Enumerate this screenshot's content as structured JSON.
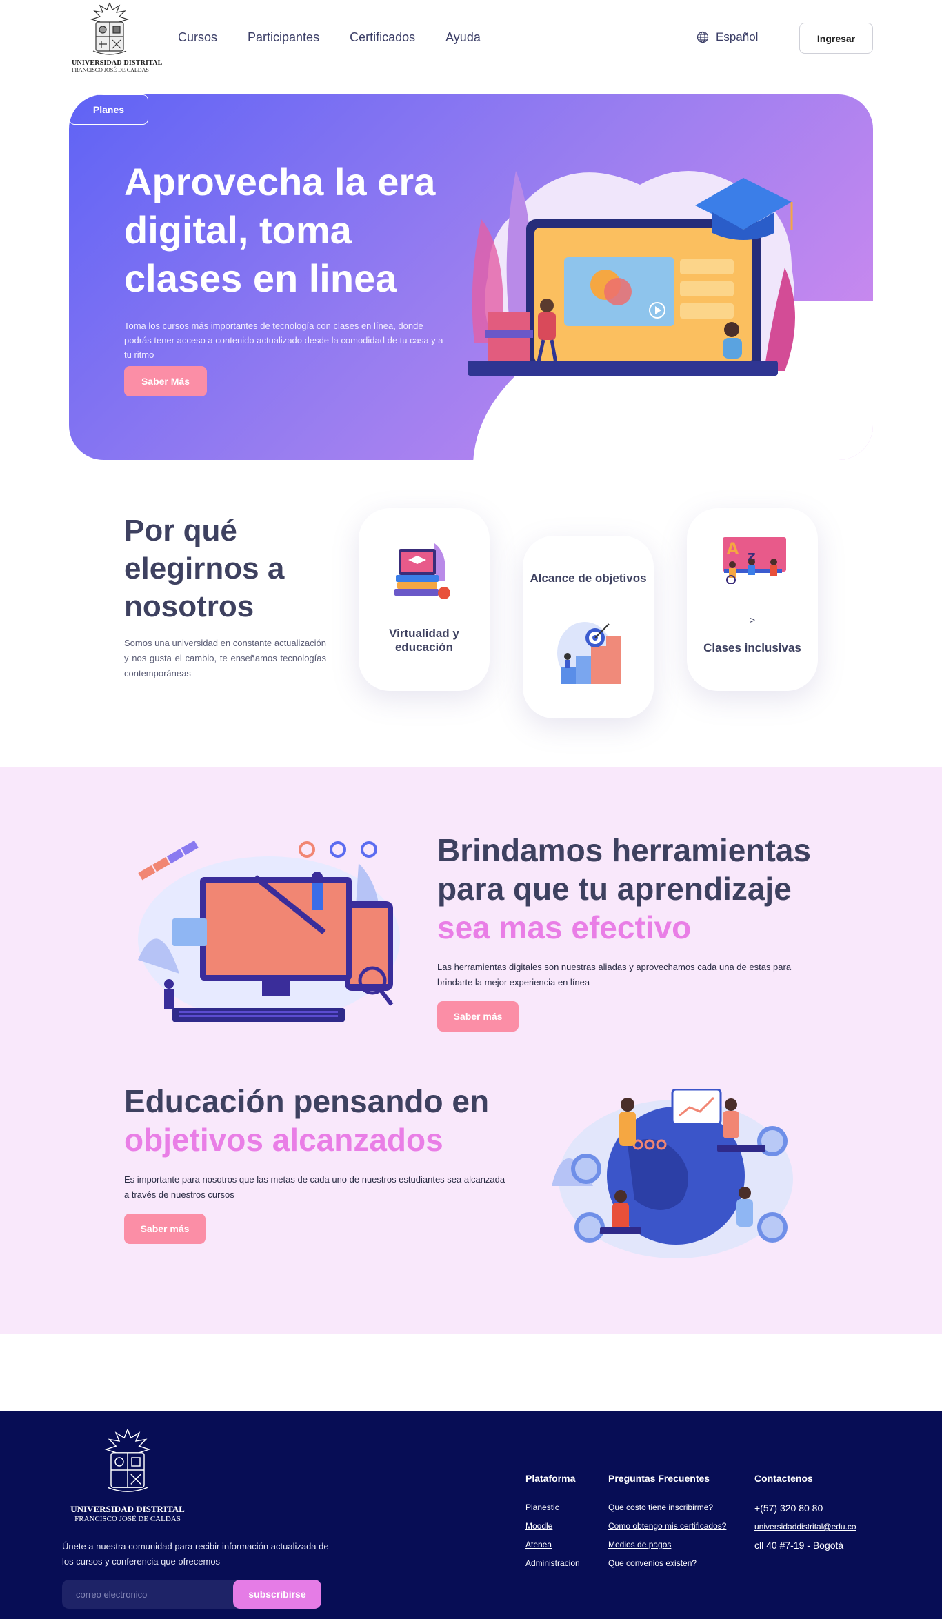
{
  "header": {
    "logo_line1": "UNIVERSIDAD DISTRITAL",
    "logo_line2": "FRANCISCO JOSÉ DE CALDAS",
    "nav": [
      "Cursos",
      "Participantes",
      "Certificados",
      "Ayuda"
    ],
    "language": "Español",
    "login_label": "Ingresar"
  },
  "hero": {
    "title": "Aprovecha la era digital, toma clases en linea",
    "text": "Toma los cursos más importantes de tecnología con clases en línea, donde podrás tener acceso a contenido actualizado desde la comodidad de tu casa y a tu ritmo",
    "primary_label": "Saber Más",
    "secondary_label": "Planes"
  },
  "why": {
    "title": "Por qué elegirnos a nosotros",
    "text": "Somos una universidad en constante actualización y nos gusta el cambio, te enseñamos tecnologías contemporáneas",
    "cards": [
      {
        "label": "Virtualidad y educación"
      },
      {
        "label": "Alcance de objetivos"
      },
      {
        "label": "Clases inclusivas",
        "arrow": ">"
      }
    ]
  },
  "tools": {
    "title": "Brindamos herramientas para que tu aprendizaje",
    "title_accent": "sea mas efectivo",
    "text": "Las herramientas digitales son nuestras aliadas y aprovechamos cada una de estas para brindarte la mejor experiencia en línea",
    "button_label": "Saber más"
  },
  "goals": {
    "title": "Educación pensando en",
    "title_accent": "objetivos alcanzados",
    "text": "Es importante para nosotros que las metas de cada uno de nuestros estudiantes sea alcanzada a través de nuestros cursos",
    "button_label": "Saber más"
  },
  "footer": {
    "logo_line1": "UNIVERSIDAD DISTRITAL",
    "logo_line2": "FRANCISCO JOSÉ DE CALDAS",
    "text": "Únete a nuestra comunidad para recibir información actualizada de los cursos y conferencia que ofrecemos",
    "email_placeholder": "correo electronico",
    "subscribe_label": "subscribirse",
    "platform": {
      "title": "Plataforma",
      "links": [
        "Planestic",
        "Moodle",
        "Atenea",
        "Administracion"
      ]
    },
    "faq": {
      "title": "Preguntas Frecuentes",
      "links": [
        "Que costo tiene inscribirme?",
        "Como obtengo mis certificados?",
        "Medios de pagos",
        "Que convenios existen?"
      ]
    },
    "contact": {
      "title": "Contactenos",
      "phone": "+(57) 320 80 80",
      "email": "universidaddistrital@edu.co",
      "address": "cll 40 #7-19 - Bogotá"
    }
  },
  "colors": {
    "accent": "#fb8ea6",
    "purple": "#e97ee6",
    "footer_bg": "#070d55",
    "section_bg": "#f9e8fb"
  }
}
